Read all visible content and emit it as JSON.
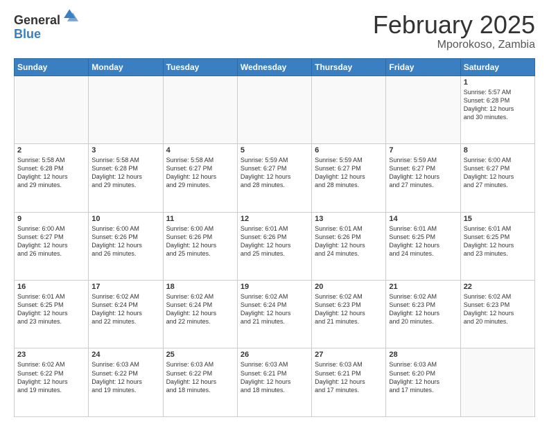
{
  "logo": {
    "general": "General",
    "blue": "Blue"
  },
  "header": {
    "month": "February 2025",
    "location": "Mporokoso, Zambia"
  },
  "weekdays": [
    "Sunday",
    "Monday",
    "Tuesday",
    "Wednesday",
    "Thursday",
    "Friday",
    "Saturday"
  ],
  "weeks": [
    [
      {
        "day": "",
        "info": ""
      },
      {
        "day": "",
        "info": ""
      },
      {
        "day": "",
        "info": ""
      },
      {
        "day": "",
        "info": ""
      },
      {
        "day": "",
        "info": ""
      },
      {
        "day": "",
        "info": ""
      },
      {
        "day": "1",
        "info": "Sunrise: 5:57 AM\nSunset: 6:28 PM\nDaylight: 12 hours\nand 30 minutes."
      }
    ],
    [
      {
        "day": "2",
        "info": "Sunrise: 5:58 AM\nSunset: 6:28 PM\nDaylight: 12 hours\nand 29 minutes."
      },
      {
        "day": "3",
        "info": "Sunrise: 5:58 AM\nSunset: 6:28 PM\nDaylight: 12 hours\nand 29 minutes."
      },
      {
        "day": "4",
        "info": "Sunrise: 5:58 AM\nSunset: 6:27 PM\nDaylight: 12 hours\nand 29 minutes."
      },
      {
        "day": "5",
        "info": "Sunrise: 5:59 AM\nSunset: 6:27 PM\nDaylight: 12 hours\nand 28 minutes."
      },
      {
        "day": "6",
        "info": "Sunrise: 5:59 AM\nSunset: 6:27 PM\nDaylight: 12 hours\nand 28 minutes."
      },
      {
        "day": "7",
        "info": "Sunrise: 5:59 AM\nSunset: 6:27 PM\nDaylight: 12 hours\nand 27 minutes."
      },
      {
        "day": "8",
        "info": "Sunrise: 6:00 AM\nSunset: 6:27 PM\nDaylight: 12 hours\nand 27 minutes."
      }
    ],
    [
      {
        "day": "9",
        "info": "Sunrise: 6:00 AM\nSunset: 6:27 PM\nDaylight: 12 hours\nand 26 minutes."
      },
      {
        "day": "10",
        "info": "Sunrise: 6:00 AM\nSunset: 6:26 PM\nDaylight: 12 hours\nand 26 minutes."
      },
      {
        "day": "11",
        "info": "Sunrise: 6:00 AM\nSunset: 6:26 PM\nDaylight: 12 hours\nand 25 minutes."
      },
      {
        "day": "12",
        "info": "Sunrise: 6:01 AM\nSunset: 6:26 PM\nDaylight: 12 hours\nand 25 minutes."
      },
      {
        "day": "13",
        "info": "Sunrise: 6:01 AM\nSunset: 6:26 PM\nDaylight: 12 hours\nand 24 minutes."
      },
      {
        "day": "14",
        "info": "Sunrise: 6:01 AM\nSunset: 6:25 PM\nDaylight: 12 hours\nand 24 minutes."
      },
      {
        "day": "15",
        "info": "Sunrise: 6:01 AM\nSunset: 6:25 PM\nDaylight: 12 hours\nand 23 minutes."
      }
    ],
    [
      {
        "day": "16",
        "info": "Sunrise: 6:01 AM\nSunset: 6:25 PM\nDaylight: 12 hours\nand 23 minutes."
      },
      {
        "day": "17",
        "info": "Sunrise: 6:02 AM\nSunset: 6:24 PM\nDaylight: 12 hours\nand 22 minutes."
      },
      {
        "day": "18",
        "info": "Sunrise: 6:02 AM\nSunset: 6:24 PM\nDaylight: 12 hours\nand 22 minutes."
      },
      {
        "day": "19",
        "info": "Sunrise: 6:02 AM\nSunset: 6:24 PM\nDaylight: 12 hours\nand 21 minutes."
      },
      {
        "day": "20",
        "info": "Sunrise: 6:02 AM\nSunset: 6:23 PM\nDaylight: 12 hours\nand 21 minutes."
      },
      {
        "day": "21",
        "info": "Sunrise: 6:02 AM\nSunset: 6:23 PM\nDaylight: 12 hours\nand 20 minutes."
      },
      {
        "day": "22",
        "info": "Sunrise: 6:02 AM\nSunset: 6:23 PM\nDaylight: 12 hours\nand 20 minutes."
      }
    ],
    [
      {
        "day": "23",
        "info": "Sunrise: 6:02 AM\nSunset: 6:22 PM\nDaylight: 12 hours\nand 19 minutes."
      },
      {
        "day": "24",
        "info": "Sunrise: 6:03 AM\nSunset: 6:22 PM\nDaylight: 12 hours\nand 19 minutes."
      },
      {
        "day": "25",
        "info": "Sunrise: 6:03 AM\nSunset: 6:22 PM\nDaylight: 12 hours\nand 18 minutes."
      },
      {
        "day": "26",
        "info": "Sunrise: 6:03 AM\nSunset: 6:21 PM\nDaylight: 12 hours\nand 18 minutes."
      },
      {
        "day": "27",
        "info": "Sunrise: 6:03 AM\nSunset: 6:21 PM\nDaylight: 12 hours\nand 17 minutes."
      },
      {
        "day": "28",
        "info": "Sunrise: 6:03 AM\nSunset: 6:20 PM\nDaylight: 12 hours\nand 17 minutes."
      },
      {
        "day": "",
        "info": ""
      }
    ]
  ]
}
